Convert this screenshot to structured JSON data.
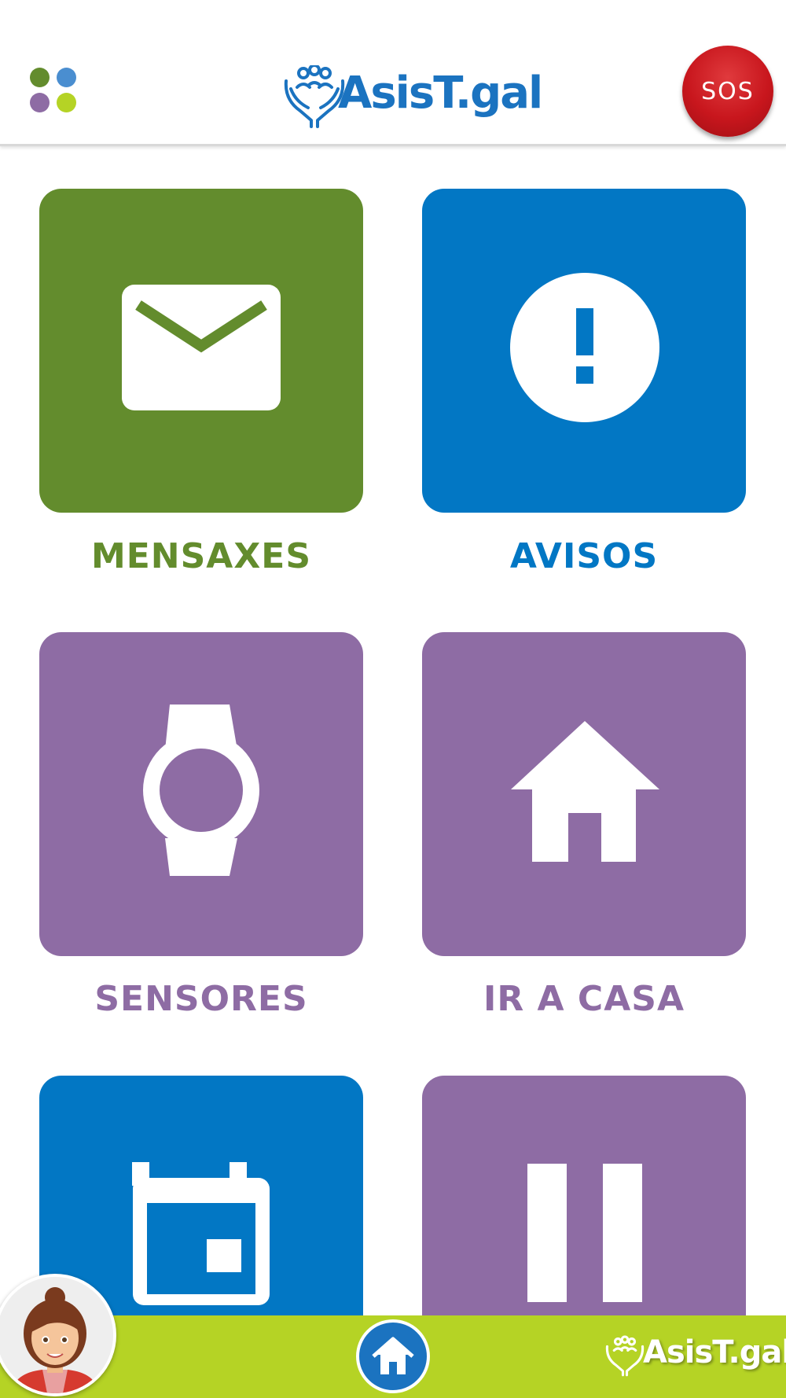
{
  "header": {
    "menu_icon": "apps-grid-icon",
    "logo_text": "AsisT.gal",
    "sos_label": "SOS"
  },
  "tiles": [
    {
      "label": "MENSAXES",
      "icon": "envelope-icon",
      "color": "#638c2d"
    },
    {
      "label": "AVISOS",
      "icon": "alert-circle-icon",
      "color": "#0277c4"
    },
    {
      "label": "SENSORES",
      "icon": "watch-icon",
      "color": "#8e6ca4"
    },
    {
      "label": "IR A CASA",
      "icon": "home-icon",
      "color": "#8e6ca4"
    },
    {
      "label": "",
      "icon": "calendar-icon",
      "color": "#0277c4"
    },
    {
      "label": "",
      "icon": "pause-icon",
      "color": "#8e6ca4"
    }
  ],
  "footer": {
    "home_icon": "home-icon",
    "logo_text": "AsisT.gal",
    "background": "#b5d325"
  },
  "colors": {
    "green": "#638c2d",
    "blue": "#0277c4",
    "purple": "#8e6ca4",
    "lime": "#b5d325",
    "sos_red": "#c8161d"
  }
}
